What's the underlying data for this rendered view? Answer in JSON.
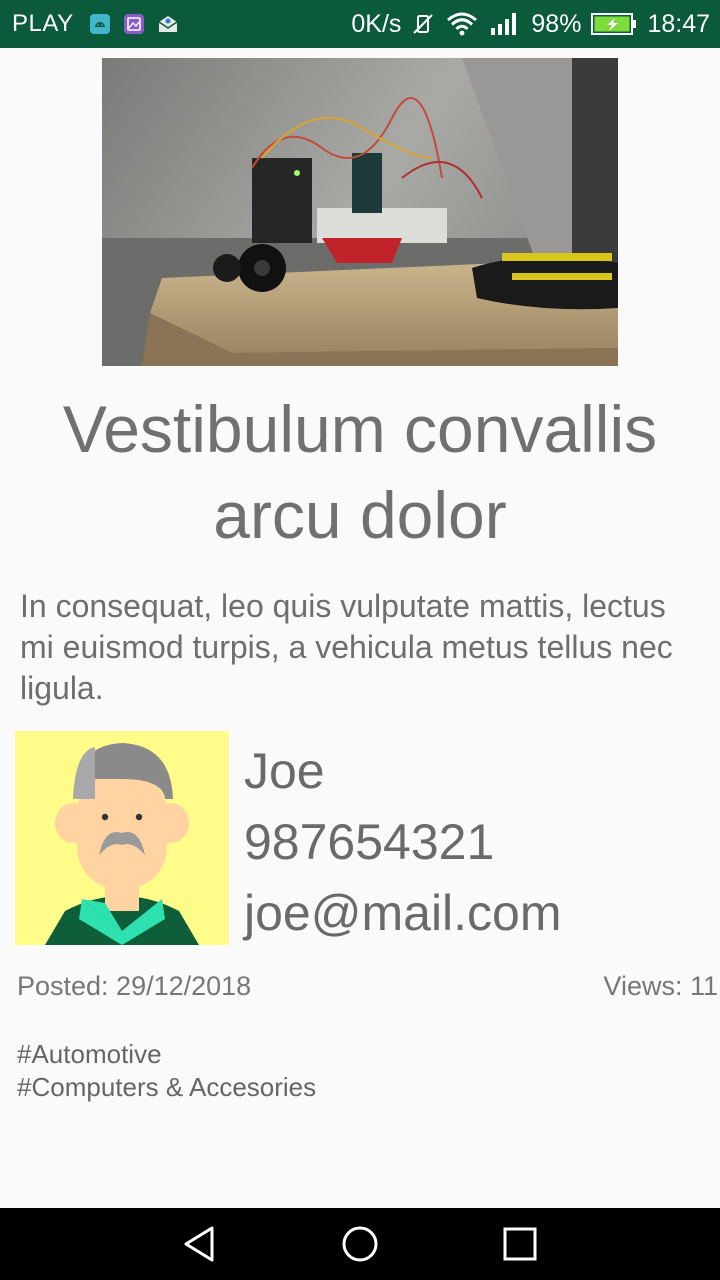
{
  "status_bar": {
    "carrier": "PLAY",
    "network_speed": "0K/s",
    "battery": "98%",
    "time": "18:47",
    "background": "#0b5a3c",
    "left_icons": [
      "android-app-icon",
      "image-app-icon",
      "mail-app-icon"
    ],
    "right_icons": [
      "muted-vibrate-icon",
      "wifi-icon",
      "signal-icon",
      "battery-charging-icon"
    ]
  },
  "post": {
    "image_alt": "hero-photo",
    "title": "Vestibulum convallis arcu dolor",
    "description": "In consequat, leo quis vulputate mattis, lectus mi euismod turpis, a vehicula metus tellus nec ligula.",
    "author": {
      "name": "Joe",
      "phone": "987654321",
      "email": "joe@mail.com"
    },
    "posted": "Posted: 29/12/2018",
    "views": "Views: 11",
    "tags": [
      "#Automotive",
      "#Computers & Accesories"
    ]
  },
  "nav_bar": {
    "buttons": [
      "back-icon",
      "home-icon",
      "recents-icon"
    ]
  }
}
